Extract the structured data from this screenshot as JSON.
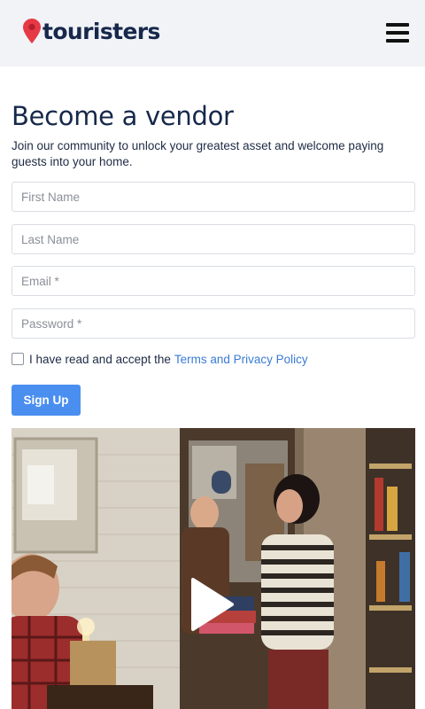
{
  "header": {
    "brand": "touristers",
    "pin_color": "#e63946",
    "menu_icon": "hamburger-menu-icon"
  },
  "page": {
    "title": "Become a vendor",
    "subtitle": "Join our community to unlock your greatest asset and welcome paying guests into your home."
  },
  "form": {
    "first_name_placeholder": "First Name",
    "last_name_placeholder": "Last Name",
    "email_placeholder": "Email *",
    "password_placeholder": "Password *",
    "terms_prefix": "I have read and accept the",
    "terms_link": "Terms and Privacy Policy",
    "submit_label": "Sign Up"
  },
  "video": {
    "play_icon": "play-icon"
  },
  "colors": {
    "brand": "#17284b",
    "accent": "#4a8ef0",
    "link": "#3a7bd5",
    "header_bg": "#f1f3f7"
  }
}
